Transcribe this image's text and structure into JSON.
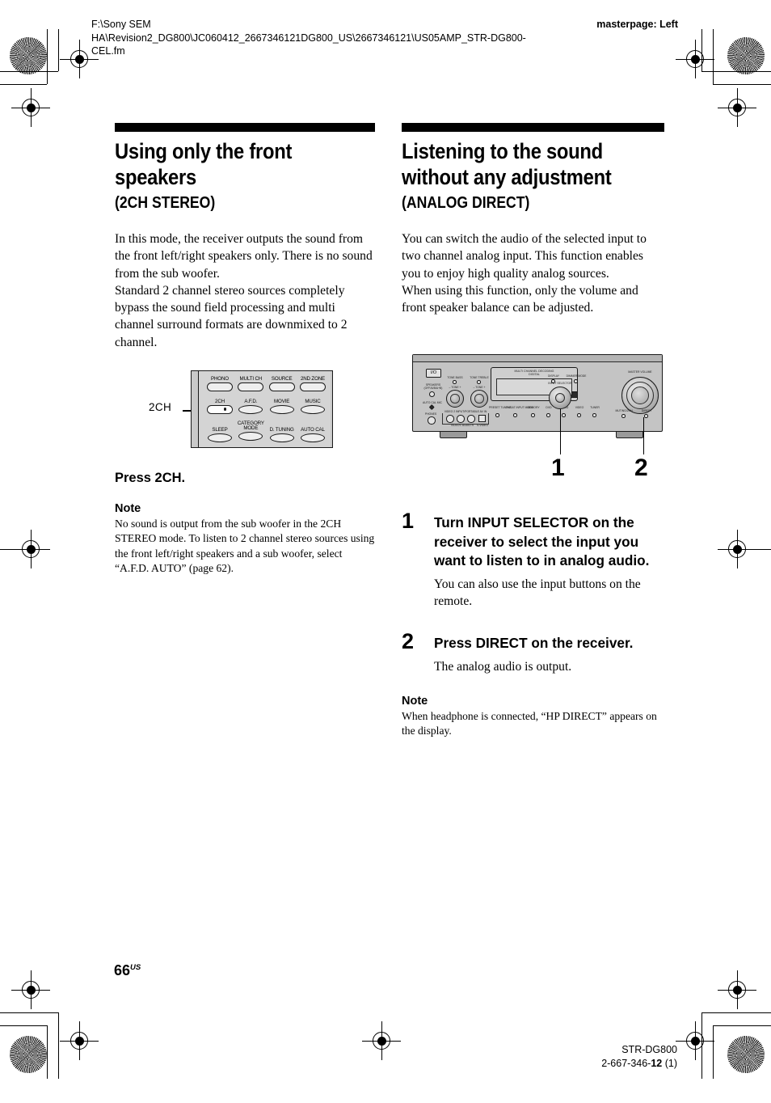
{
  "header": {
    "file_path": "F:\\Sony SEM\nHA\\Revision2_DG800\\JC060412_2667346121DG800_US\\2667346121\\US05AMP_STR-DG800-\nCEL.fm",
    "masterpage": "masterpage: Left"
  },
  "left_column": {
    "title": "Using only the front speakers",
    "subtitle": "(2CH STEREO)",
    "body": "In this mode, the receiver outputs the sound from the front left/right speakers only. There is no sound from the sub woofer.\nStandard 2 channel stereo sources completely bypass the sound field processing and multi channel surround formats are downmixed to 2 channel.",
    "figure": {
      "callout_label": "2CH",
      "remote_buttons": [
        [
          {
            "caption": "PHONO",
            "shape": "pill",
            "highlighted": false
          },
          {
            "caption": "MULTI CH",
            "shape": "pill",
            "highlighted": false
          },
          {
            "caption": "SOURCE",
            "shape": "pill",
            "highlighted": false
          },
          {
            "caption": "2ND ZONE",
            "shape": "pill",
            "highlighted": false
          }
        ],
        [
          {
            "caption": "2CH",
            "shape": "pill",
            "highlighted": true
          },
          {
            "caption": "A.F.D.",
            "shape": "oval",
            "highlighted": false
          },
          {
            "caption": "MOVIE",
            "shape": "oval",
            "highlighted": false
          },
          {
            "caption": "MUSIC",
            "shape": "oval",
            "highlighted": false
          }
        ],
        [
          {
            "caption": "SLEEP",
            "shape": "oval",
            "highlighted": false
          },
          {
            "caption": "CATEGORY\nMODE",
            "shape": "oval",
            "highlighted": false
          },
          {
            "caption": "D. TUNING",
            "shape": "oval",
            "highlighted": false
          },
          {
            "caption": "AUTO CAL",
            "shape": "oval",
            "highlighted": false
          }
        ]
      ]
    },
    "instruction": "Press 2CH.",
    "note_heading": "Note",
    "note_body": "No sound is output from the sub woofer in the 2CH STEREO mode. To listen to 2 channel stereo sources using the front left/right speakers and a sub woofer, select “A.F.D. AUTO” (page 62)."
  },
  "right_column": {
    "title": "Listening to the sound without any adjustment",
    "subtitle": "(ANALOG DIRECT)",
    "body": "You can switch the audio of the selected input to two channel analog input. This function enables you to enjoy high quality analog sources.\nWhen using this function, only the volume and front speaker balance can be adjusted.",
    "figure": {
      "callouts": [
        "1",
        "2"
      ],
      "power_label": "I/O",
      "display_caption": "MULTI CHANNEL DECODING\nDIGITAL",
      "knob_labels": {
        "input_selector": "INPUT SELECTOR",
        "master_volume": "MASTER VOLUME",
        "display": "DISPLAY",
        "dimmer": "DIMMER/MODE",
        "muting": "MUTING/2CH",
        "direct": "DIRECT",
        "tone_bass": "TONE BASS",
        "tone_treble": "TONE TREBLE",
        "speakers": "SPEAKERS\n(OFF/A/B/A+B)",
        "auto_cal_mic": "AUTO CAL MIC",
        "phones": "PHONES",
        "video_input": "VIDEO 2 INPUT/PORTABLE AV IN",
        "jack_labels": "VIDEO    L AUDIO R",
        "s_video": "S-VIDEO"
      },
      "panel_buttons": [
        "PRESET TUNING",
        "TV/SAT INPUT MODE",
        "MEMORY",
        "DVD",
        "SA-CD",
        "VIDEO",
        "TUNER"
      ]
    },
    "steps": [
      {
        "number": "1",
        "heading": "Turn INPUT SELECTOR on the receiver to select the input you want to listen to in analog audio.",
        "sub": "You can also use the input buttons on the remote."
      },
      {
        "number": "2",
        "heading": "Press DIRECT on the receiver.",
        "sub": "The analog audio is output."
      }
    ],
    "note_heading": "Note",
    "note_body": "When headphone is connected, “HP DIRECT” appears on the display."
  },
  "footer": {
    "page_number": "66",
    "page_suffix": "US",
    "model": "STR-DG800",
    "part_prefix": "2-667-346-",
    "part_bold": "12",
    "part_suffix": " (1)"
  },
  "colors": {
    "rule": "#000000",
    "device_body": "#c4c4c4",
    "remote_body": "#d4d4d4"
  }
}
